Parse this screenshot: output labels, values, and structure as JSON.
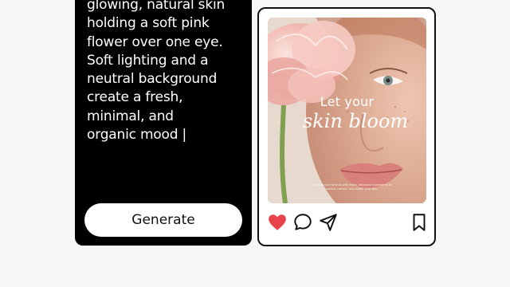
{
  "prompt": {
    "text": "glowing, natural skin\nholding a soft pink\nflower over one eye.\nSoft lighting and a\nneutral background\ncreate a fresh,\nminimal, and\norganic mood |"
  },
  "generate_button": {
    "label": "Generate"
  },
  "post": {
    "headline": "Let your",
    "headline_script": "skin bloom",
    "fineprint": "Our bioactive formula with clean, botanical ingredients to hydrate, restore, and soften your skin.",
    "icons": {
      "like": "heart-icon",
      "comment": "comment-icon",
      "share": "send-icon",
      "save": "bookmark-icon"
    },
    "like_active": true
  },
  "colors": {
    "card_dark": "#000000",
    "like_red": "#e8434b",
    "outline": "#111111",
    "background": "#f7f7f7"
  }
}
